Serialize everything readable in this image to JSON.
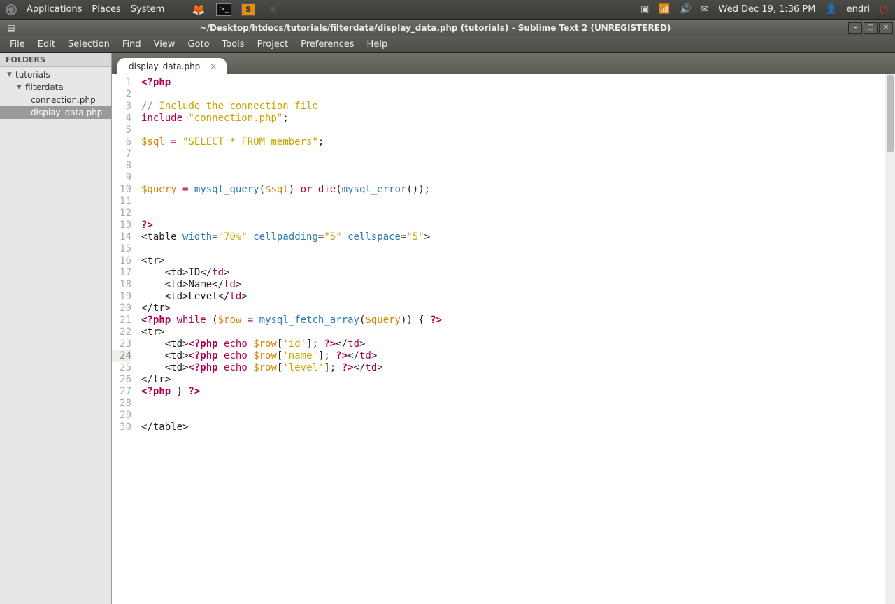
{
  "panel": {
    "menus": [
      "Applications",
      "Places",
      "System"
    ],
    "datetime": "Wed Dec 19,  1:36 PM",
    "user": "endri"
  },
  "window": {
    "title": "~/Desktop/htdocs/tutorials/filterdata/display_data.php (tutorials) - Sublime Text 2 (UNREGISTERED)",
    "menus": [
      "File",
      "Edit",
      "Selection",
      "Find",
      "View",
      "Goto",
      "Tools",
      "Project",
      "Preferences",
      "Help"
    ]
  },
  "sidebar": {
    "header": "FOLDERS",
    "root": "tutorials",
    "folder": "filterdata",
    "files": [
      "connection.php",
      "display_data.php"
    ],
    "selected": "display_data.php"
  },
  "tab": {
    "label": "display_data.php"
  },
  "editor": {
    "current_line": 24,
    "lines": 30
  },
  "code_tokens": [
    [
      [
        "kw",
        "<?php"
      ]
    ],
    [],
    [
      [
        "cmt",
        "// "
      ],
      [
        "cmt2",
        "Include the connection file"
      ]
    ],
    [
      [
        "kw2",
        "include"
      ],
      [
        "punct",
        " "
      ],
      [
        "str",
        "\"connection.php\""
      ],
      [
        "punct",
        ";"
      ]
    ],
    [],
    [
      [
        "var",
        "$sql"
      ],
      [
        "punct",
        " "
      ],
      [
        "op",
        "="
      ],
      [
        "punct",
        " "
      ],
      [
        "str",
        "\"SELECT * FROM members\""
      ],
      [
        "punct",
        ";"
      ]
    ],
    [],
    [],
    [],
    [
      [
        "var",
        "$query"
      ],
      [
        "punct",
        " "
      ],
      [
        "op",
        "="
      ],
      [
        "punct",
        " "
      ],
      [
        "func",
        "mysql_query"
      ],
      [
        "punct",
        "("
      ],
      [
        "var",
        "$sql"
      ],
      [
        "punct",
        ") "
      ],
      [
        "kw2",
        "or"
      ],
      [
        "punct",
        " "
      ],
      [
        "kw2",
        "die"
      ],
      [
        "punct",
        "("
      ],
      [
        "func",
        "mysql_error"
      ],
      [
        "punct",
        "());"
      ]
    ],
    [],
    [],
    [
      [
        "kw",
        "?>"
      ]
    ],
    [
      [
        "tagp",
        "<"
      ],
      [
        "tagp",
        "table "
      ],
      [
        "attr",
        "width"
      ],
      [
        "tagp",
        "="
      ],
      [
        "str",
        "\"70%\""
      ],
      [
        "tagp",
        " "
      ],
      [
        "attr",
        "cellpadding"
      ],
      [
        "tagp",
        "="
      ],
      [
        "str",
        "\"5\""
      ],
      [
        "tagp",
        " "
      ],
      [
        "attr",
        "cellspace"
      ],
      [
        "tagp",
        "="
      ],
      [
        "str",
        "\"5\""
      ],
      [
        "tagp",
        ">"
      ]
    ],
    [],
    [
      [
        "tagp",
        "<"
      ],
      [
        "tagp",
        "tr"
      ],
      [
        "tagp",
        ">"
      ]
    ],
    [
      [
        "punct",
        "    "
      ],
      [
        "tagp",
        "<"
      ],
      [
        "tagp",
        "td"
      ],
      [
        "tagp",
        ">"
      ],
      [
        "punct",
        "ID"
      ],
      [
        "tagp",
        "</"
      ],
      [
        "tagn",
        "td"
      ],
      [
        "tagp",
        ">"
      ]
    ],
    [
      [
        "punct",
        "    "
      ],
      [
        "tagp",
        "<"
      ],
      [
        "tagp",
        "td"
      ],
      [
        "tagp",
        ">"
      ],
      [
        "punct",
        "Name"
      ],
      [
        "tagp",
        "</"
      ],
      [
        "tagn",
        "td"
      ],
      [
        "tagp",
        ">"
      ]
    ],
    [
      [
        "punct",
        "    "
      ],
      [
        "tagp",
        "<"
      ],
      [
        "tagp",
        "td"
      ],
      [
        "tagp",
        ">"
      ],
      [
        "punct",
        "Level"
      ],
      [
        "tagp",
        "</"
      ],
      [
        "tagn",
        "td"
      ],
      [
        "tagp",
        ">"
      ]
    ],
    [
      [
        "tagp",
        "</"
      ],
      [
        "tagp",
        "tr"
      ],
      [
        "tagp",
        ">"
      ]
    ],
    [
      [
        "kw",
        "<?php"
      ],
      [
        "punct",
        " "
      ],
      [
        "kw2",
        "while"
      ],
      [
        "punct",
        " ("
      ],
      [
        "var",
        "$row"
      ],
      [
        "punct",
        " "
      ],
      [
        "op",
        "="
      ],
      [
        "punct",
        " "
      ],
      [
        "func",
        "mysql_fetch_array"
      ],
      [
        "punct",
        "("
      ],
      [
        "var",
        "$query"
      ],
      [
        "punct",
        ")) { "
      ],
      [
        "kw",
        "?>"
      ]
    ],
    [
      [
        "tagp",
        "<"
      ],
      [
        "tagp",
        "tr"
      ],
      [
        "tagp",
        ">"
      ]
    ],
    [
      [
        "punct",
        "    "
      ],
      [
        "tagp",
        "<"
      ],
      [
        "tagp",
        "td"
      ],
      [
        "tagp",
        ">"
      ],
      [
        "kw",
        "<?php"
      ],
      [
        "punct",
        " "
      ],
      [
        "kw2",
        "echo"
      ],
      [
        "punct",
        " "
      ],
      [
        "var",
        "$row"
      ],
      [
        "punct",
        "["
      ],
      [
        "str",
        "'id'"
      ],
      [
        "punct",
        "]; "
      ],
      [
        "kw",
        "?>"
      ],
      [
        "tagp",
        "</"
      ],
      [
        "tagn",
        "td"
      ],
      [
        "tagp",
        ">"
      ]
    ],
    [
      [
        "punct",
        "    "
      ],
      [
        "tagp",
        "<"
      ],
      [
        "tagp",
        "td"
      ],
      [
        "tagp",
        ">"
      ],
      [
        "kw",
        "<?php"
      ],
      [
        "punct",
        " "
      ],
      [
        "kw2",
        "echo"
      ],
      [
        "punct",
        " "
      ],
      [
        "var",
        "$row"
      ],
      [
        "punct",
        "["
      ],
      [
        "str",
        "'name'"
      ],
      [
        "punct",
        "]; "
      ],
      [
        "kw",
        "?>"
      ],
      [
        "tagp",
        "</"
      ],
      [
        "tagn",
        "td"
      ],
      [
        "tagp",
        ">"
      ]
    ],
    [
      [
        "punct",
        "    "
      ],
      [
        "tagp",
        "<"
      ],
      [
        "tagp",
        "td"
      ],
      [
        "tagp",
        ">"
      ],
      [
        "kw",
        "<?php"
      ],
      [
        "punct",
        " "
      ],
      [
        "kw2",
        "echo"
      ],
      [
        "punct",
        " "
      ],
      [
        "var",
        "$row"
      ],
      [
        "punct",
        "["
      ],
      [
        "str",
        "'level'"
      ],
      [
        "punct",
        "]; "
      ],
      [
        "kw",
        "?>"
      ],
      [
        "tagp",
        "</"
      ],
      [
        "tagn",
        "td"
      ],
      [
        "tagp",
        ">"
      ]
    ],
    [
      [
        "tagp",
        "</"
      ],
      [
        "tagp",
        "tr"
      ],
      [
        "tagp",
        ">"
      ]
    ],
    [
      [
        "kw",
        "<?php"
      ],
      [
        "punct",
        " } "
      ],
      [
        "kw",
        "?>"
      ]
    ],
    [],
    [],
    [
      [
        "tagp",
        "</"
      ],
      [
        "tagp",
        "table"
      ],
      [
        "tagp",
        ">"
      ]
    ]
  ]
}
